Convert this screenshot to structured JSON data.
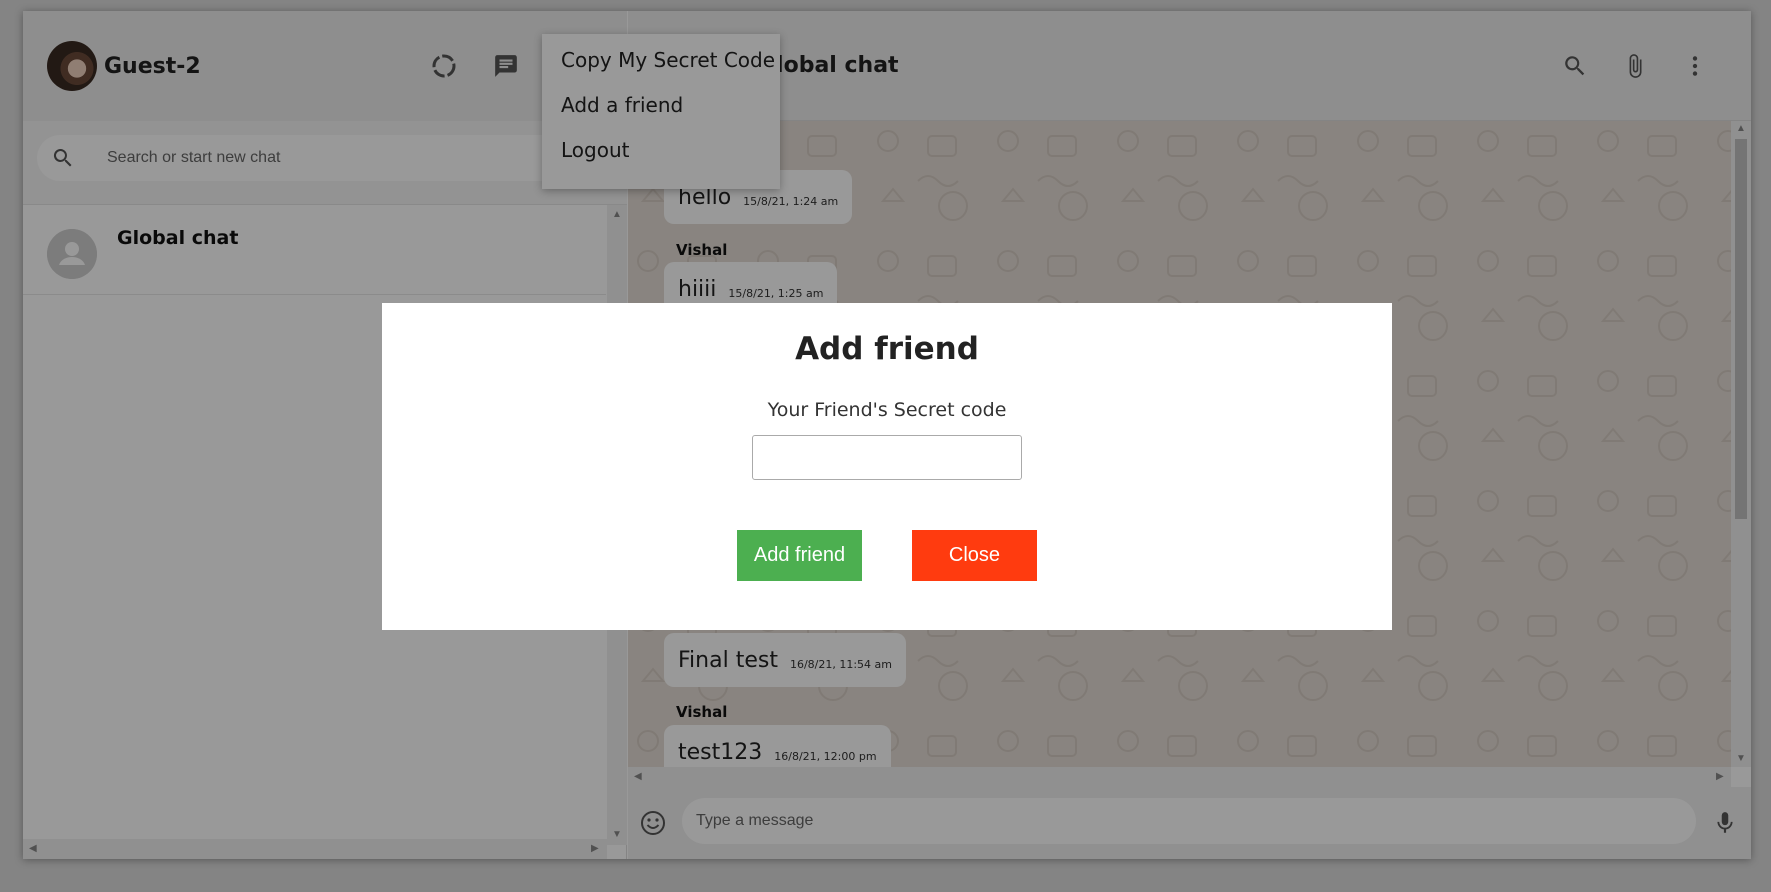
{
  "sidebar": {
    "user_name": "Guest-2",
    "search_placeholder": "Search or start new chat",
    "chats": [
      {
        "name": "Global chat"
      }
    ]
  },
  "main": {
    "title": "Global chat",
    "messages": [
      {
        "sender": "",
        "text": "hello",
        "time": "15/8/21, 1:24 am"
      },
      {
        "sender": "Vishal",
        "text": "hiiii",
        "time": "15/8/21, 1:25 am"
      },
      {
        "sender": "",
        "text": "Final test",
        "time": "16/8/21, 11:54 am"
      },
      {
        "sender": "Vishal",
        "text": "test123",
        "time": "16/8/21, 12:00 pm"
      }
    ],
    "composer_placeholder": "Type a message"
  },
  "menu": {
    "items": [
      "Copy My Secret Code",
      "Add a friend",
      "Logout"
    ]
  },
  "modal": {
    "title": "Add friend",
    "label": "Your Friend's Secret code",
    "input_value": "",
    "add_button": "Add friend",
    "close_button": "Close"
  },
  "colors": {
    "add_button": "#4caf50",
    "close_button": "#ff3b0f",
    "chat_background": "#e5ddd5"
  }
}
